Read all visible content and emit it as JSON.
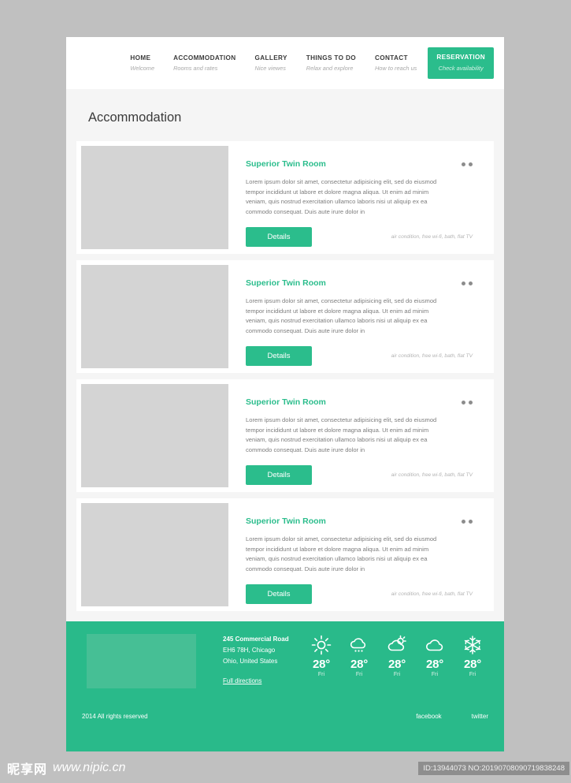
{
  "header": {
    "nav": [
      {
        "label": "HOME",
        "sub": "Welcome"
      },
      {
        "label": "ACCOMMODATION",
        "sub": "Rooms and rates"
      },
      {
        "label": "GALLERY",
        "sub": "Nice viewes"
      },
      {
        "label": "THINGS TO DO",
        "sub": "Relax and explore"
      },
      {
        "label": "CONTACT",
        "sub": "How to reach us"
      }
    ],
    "reservation": {
      "label": "RESERVATION",
      "sub": "Check availability"
    }
  },
  "main": {
    "title": "Accommodation",
    "rooms": [
      {
        "title": "Superior Twin Room",
        "description": "Lorem ipsum dolor sit amet, consectetur adipisicing elit, sed do eiusmod tempor incididunt ut labore et dolore magna aliqua. Ut enim ad minim veniam, quis nostrud exercitation ullamco laboris nisi ut aliquip ex ea commodo consequat. Duis aute irure dolor in",
        "button": "Details",
        "amenities": "air condition, free wi-fi, bath, flat TV"
      },
      {
        "title": "Superior Twin Room",
        "description": "Lorem ipsum dolor sit amet, consectetur adipisicing elit, sed do eiusmod tempor incididunt ut labore et dolore magna aliqua. Ut enim ad minim veniam, quis nostrud exercitation ullamco laboris nisi ut aliquip ex ea commodo consequat. Duis aute irure dolor in",
        "button": "Details",
        "amenities": "air condition, free wi-fi, bath, flat TV"
      },
      {
        "title": "Superior Twin Room",
        "description": "Lorem ipsum dolor sit amet, consectetur adipisicing elit, sed do eiusmod tempor incididunt ut labore et dolore magna aliqua. Ut enim ad minim veniam, quis nostrud exercitation ullamco laboris nisi ut aliquip ex ea commodo consequat. Duis aute irure dolor in",
        "button": "Details",
        "amenities": "air condition, free wi-fi, bath, flat TV"
      },
      {
        "title": "Superior Twin Room",
        "description": "Lorem ipsum dolor sit amet, consectetur adipisicing elit, sed do eiusmod tempor incididunt ut labore et dolore magna aliqua. Ut enim ad minim veniam, quis nostrud exercitation ullamco laboris nisi ut aliquip ex ea commodo consequat. Duis aute irure dolor in",
        "button": "Details",
        "amenities": "air condition, free wi-fi, bath, flat TV"
      }
    ]
  },
  "footer": {
    "address": {
      "line1": "245 Commercial Road",
      "line2": "EH6 78H, Chicago",
      "line3": "Ohio, United States",
      "link": "Full directions"
    },
    "weather": [
      {
        "icon": "sun-icon",
        "temp": "28°",
        "day": "Fri"
      },
      {
        "icon": "rain-cloud-icon",
        "temp": "28°",
        "day": "Fri"
      },
      {
        "icon": "sun-behind-cloud-icon",
        "temp": "28°",
        "day": "Fri"
      },
      {
        "icon": "cloud-icon",
        "temp": "28°",
        "day": "Fri"
      },
      {
        "icon": "snowflake-icon",
        "temp": "28°",
        "day": "Fri"
      }
    ],
    "copyright": "2014 All rights reserved",
    "social": [
      {
        "label": "facebook"
      },
      {
        "label": "twitter"
      }
    ]
  },
  "watermark": {
    "logo": "昵享网",
    "site": "www.nipic.cn",
    "id": "ID:13944073 NO:20190708090719838248"
  },
  "colors": {
    "brand_green": "#2bbd8c",
    "footer_green": "#29ba8a",
    "page_background": "#f5f5f5",
    "backdrop_gray": "#c0c0c0",
    "thumb_gray": "#d4d4d4",
    "body_text": "#7d7d7d"
  }
}
